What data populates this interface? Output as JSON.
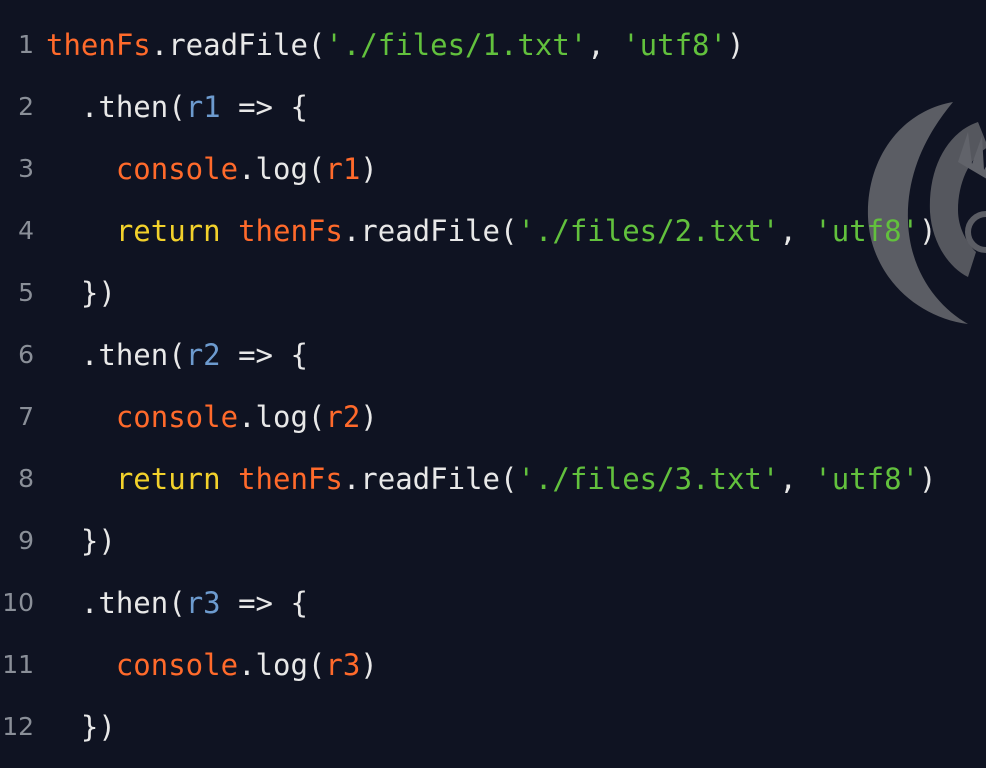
{
  "colors": {
    "background": "#0f1322",
    "line_number": "#8a8f98",
    "object": "#ff6a2b",
    "default": "#e8e8e8",
    "string": "#62c13d",
    "param": "#6d9bcf",
    "keyword": "#f2d12b"
  },
  "watermark": {
    "icon": "watermark-logo-icon"
  },
  "lines": [
    {
      "number": "1",
      "indent": "",
      "tokens": [
        {
          "t": "thenFs",
          "k": "obj"
        },
        {
          "t": ".readFile(",
          "k": "method"
        },
        {
          "t": "'./files/1.txt'",
          "k": "str"
        },
        {
          "t": ", ",
          "k": "punc"
        },
        {
          "t": "'utf8'",
          "k": "str"
        },
        {
          "t": ")",
          "k": "punc"
        }
      ]
    },
    {
      "number": "2",
      "indent": "  ",
      "tokens": [
        {
          "t": ".then(",
          "k": "method"
        },
        {
          "t": "r1",
          "k": "param"
        },
        {
          "t": " => {",
          "k": "punc"
        }
      ]
    },
    {
      "number": "3",
      "indent": "    ",
      "tokens": [
        {
          "t": "console",
          "k": "obj"
        },
        {
          "t": ".log(",
          "k": "method"
        },
        {
          "t": "r1",
          "k": "arg"
        },
        {
          "t": ")",
          "k": "punc"
        }
      ]
    },
    {
      "number": "4",
      "indent": "    ",
      "tokens": [
        {
          "t": "return",
          "k": "kw"
        },
        {
          "t": " ",
          "k": "punc"
        },
        {
          "t": "thenFs",
          "k": "obj"
        },
        {
          "t": ".readFile(",
          "k": "method"
        },
        {
          "t": "'./files/2.txt'",
          "k": "str"
        },
        {
          "t": ", ",
          "k": "punc"
        },
        {
          "t": "'utf8'",
          "k": "str"
        },
        {
          "t": ")",
          "k": "punc"
        }
      ]
    },
    {
      "number": "5",
      "indent": "  ",
      "tokens": [
        {
          "t": "})",
          "k": "punc"
        }
      ]
    },
    {
      "number": "6",
      "indent": "  ",
      "tokens": [
        {
          "t": ".then(",
          "k": "method"
        },
        {
          "t": "r2",
          "k": "param"
        },
        {
          "t": " => {",
          "k": "punc"
        }
      ]
    },
    {
      "number": "7",
      "indent": "    ",
      "tokens": [
        {
          "t": "console",
          "k": "obj"
        },
        {
          "t": ".log(",
          "k": "method"
        },
        {
          "t": "r2",
          "k": "arg"
        },
        {
          "t": ")",
          "k": "punc"
        }
      ]
    },
    {
      "number": "8",
      "indent": "    ",
      "tokens": [
        {
          "t": "return",
          "k": "kw"
        },
        {
          "t": " ",
          "k": "punc"
        },
        {
          "t": "thenFs",
          "k": "obj"
        },
        {
          "t": ".readFile(",
          "k": "method"
        },
        {
          "t": "'./files/3.txt'",
          "k": "str"
        },
        {
          "t": ", ",
          "k": "punc"
        },
        {
          "t": "'utf8'",
          "k": "str"
        },
        {
          "t": ")",
          "k": "punc"
        }
      ]
    },
    {
      "number": "9",
      "indent": "  ",
      "tokens": [
        {
          "t": "})",
          "k": "punc"
        }
      ]
    },
    {
      "number": "10",
      "indent": "  ",
      "tokens": [
        {
          "t": ".then(",
          "k": "method"
        },
        {
          "t": "r3",
          "k": "param"
        },
        {
          "t": " => {",
          "k": "punc"
        }
      ]
    },
    {
      "number": "11",
      "indent": "    ",
      "tokens": [
        {
          "t": "console",
          "k": "obj"
        },
        {
          "t": ".log(",
          "k": "method"
        },
        {
          "t": "r3",
          "k": "arg"
        },
        {
          "t": ")",
          "k": "punc"
        }
      ]
    },
    {
      "number": "12",
      "indent": "  ",
      "tokens": [
        {
          "t": "})",
          "k": "punc"
        }
      ]
    }
  ]
}
